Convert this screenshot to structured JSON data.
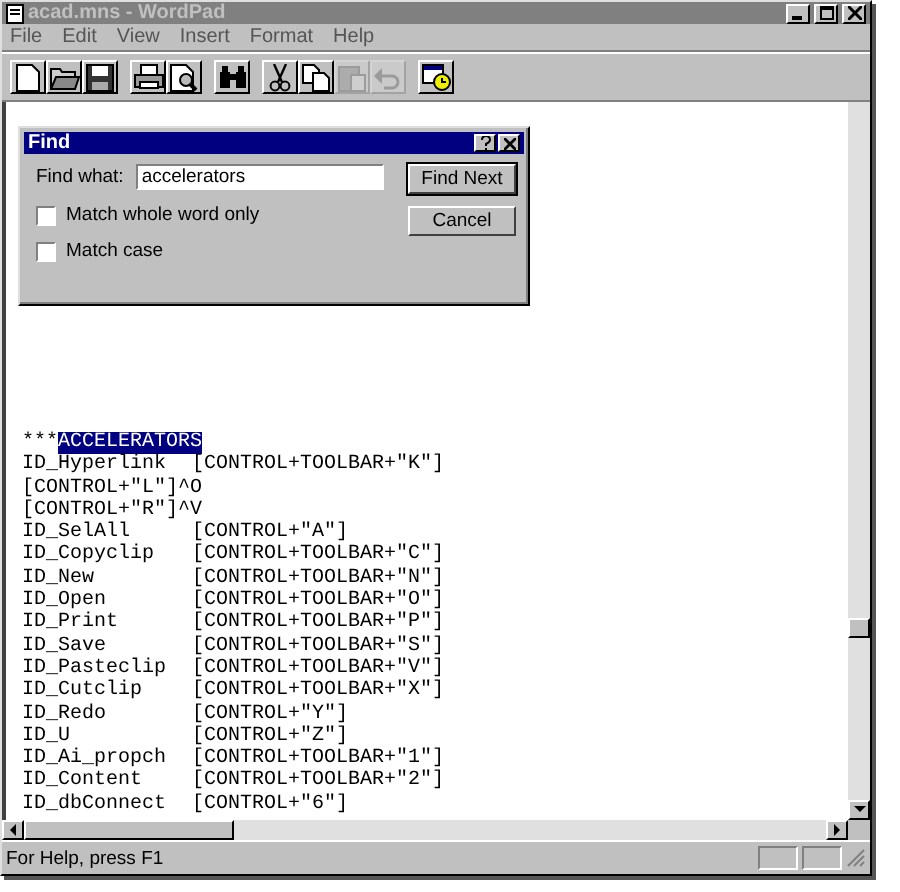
{
  "window": {
    "title": "acad.mns - WordPad"
  },
  "menu": [
    {
      "label": "File"
    },
    {
      "label": "Edit"
    },
    {
      "label": "View"
    },
    {
      "label": "Insert"
    },
    {
      "label": "Format"
    },
    {
      "label": "Help"
    }
  ],
  "toolbar": [
    {
      "kind": "new",
      "disabled": false
    },
    {
      "kind": "open",
      "disabled": false
    },
    {
      "kind": "save",
      "disabled": false
    },
    {
      "kind": "sep"
    },
    {
      "kind": "print",
      "disabled": false
    },
    {
      "kind": "preview",
      "disabled": false
    },
    {
      "kind": "sep"
    },
    {
      "kind": "find",
      "disabled": false
    },
    {
      "kind": "sep"
    },
    {
      "kind": "cut",
      "disabled": false
    },
    {
      "kind": "copy",
      "disabled": false
    },
    {
      "kind": "paste",
      "disabled": true
    },
    {
      "kind": "undo",
      "disabled": true
    },
    {
      "kind": "sep"
    },
    {
      "kind": "datetime",
      "disabled": false
    }
  ],
  "find_dialog": {
    "title": "Find",
    "find_what_label": "Find what:",
    "find_what_value": "accelerators",
    "options": [
      {
        "label": "Match whole word only",
        "checked": false
      },
      {
        "label": "Match case",
        "checked": false
      }
    ],
    "buttons": [
      {
        "label": "Find Next",
        "default": true
      },
      {
        "label": "Cancel",
        "default": false
      }
    ]
  },
  "document": {
    "lines": [
      {
        "kind": "match",
        "text": "***",
        "match": "ACCELERATORS",
        "selected": true
      },
      {
        "kind": "pair",
        "name": "ID_Hyperlink",
        "keys": "[CONTROL+TOOLBAR+\"K\"]"
      },
      {
        "kind": "single",
        "text": "[CONTROL+\"L\"]^O"
      },
      {
        "kind": "single",
        "text": "[CONTROL+\"R\"]^V"
      },
      {
        "kind": "pair",
        "name": "ID_SelAll",
        "keys": "[CONTROL+\"A\"]"
      },
      {
        "kind": "pair",
        "name": "ID_Copyclip",
        "keys": "[CONTROL+TOOLBAR+\"C\"]"
      },
      {
        "kind": "pair",
        "name": "ID_New",
        "keys": "[CONTROL+TOOLBAR+\"N\"]"
      },
      {
        "kind": "pair",
        "name": "ID_Open",
        "keys": "[CONTROL+TOOLBAR+\"O\"]"
      },
      {
        "kind": "pair",
        "name": "ID_Print",
        "keys": "[CONTROL+TOOLBAR+\"P\"]"
      },
      {
        "kind": "pair",
        "name": "ID_Save",
        "keys": "[CONTROL+TOOLBAR+\"S\"]"
      },
      {
        "kind": "pair",
        "name": "ID_Pasteclip",
        "keys": "[CONTROL+TOOLBAR+\"V\"]"
      },
      {
        "kind": "pair",
        "name": "ID_Cutclip",
        "keys": "[CONTROL+TOOLBAR+\"X\"]"
      },
      {
        "kind": "pair",
        "name": "ID_Redo",
        "keys": "[CONTROL+\"Y\"]"
      },
      {
        "kind": "pair",
        "name": "ID_U",
        "keys": "[CONTROL+\"Z\"]"
      },
      {
        "kind": "pair",
        "name": "ID_Ai_propch",
        "keys": "[CONTROL+TOOLBAR+\"1\"]"
      },
      {
        "kind": "pair",
        "name": "ID_Content",
        "keys": "[CONTROL+TOOLBAR+\"2\"]"
      },
      {
        "kind": "pair",
        "name": "ID_dbConnect",
        "keys": "[CONTROL+\"6\"]"
      }
    ]
  },
  "status_bar": {
    "text": "For Help, press F1"
  }
}
